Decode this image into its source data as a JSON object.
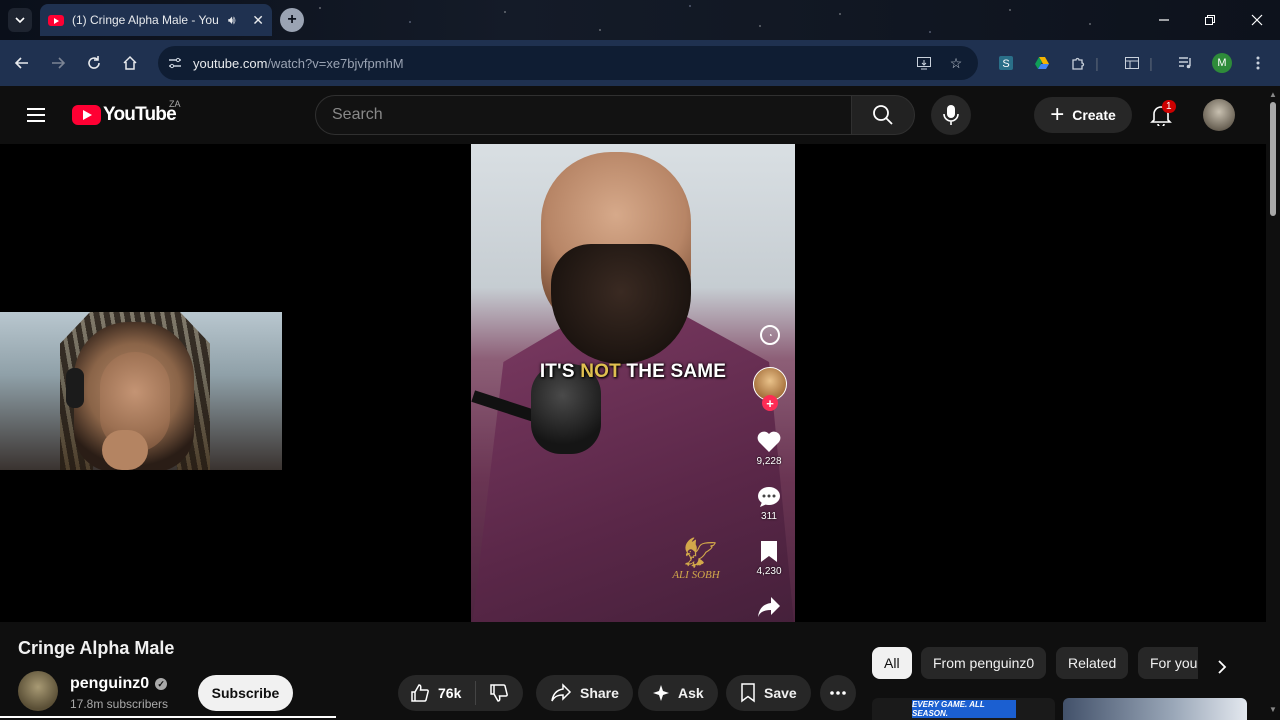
{
  "browser": {
    "tab_title": "(1) Cringe Alpha Male - You",
    "url_host": "youtube.com",
    "url_path": "/watch?v=xe7bjvfpmhM",
    "profile_initial": "M"
  },
  "masthead": {
    "logo_text": "YouTube",
    "country_code": "ZA",
    "search_placeholder": "Search",
    "create_label": "Create",
    "notification_count": "1"
  },
  "video_overlay": {
    "caption_pre": "IT'S ",
    "caption_highlight": "NOT",
    "caption_post": " THE SAME",
    "likes": "9,228",
    "comments": "311",
    "saves": "4,230",
    "watermark": "ALI SOBH"
  },
  "video": {
    "title": "Cringe Alpha Male",
    "channel_name": "penguinz0",
    "subscribers": "17.8m subscribers",
    "subscribe_label": "Subscribe",
    "like_count": "76k",
    "share_label": "Share",
    "ask_label": "Ask",
    "save_label": "Save"
  },
  "chips": [
    "All",
    "From penguinz0",
    "Related",
    "For you"
  ],
  "thumbnail_text": "EVERY GAME. ALL SEASON.",
  "colors": {
    "youtube_red": "#ff0033",
    "caption_highlight": "#e0c050",
    "tiktok_pink": "#fe2c55"
  }
}
